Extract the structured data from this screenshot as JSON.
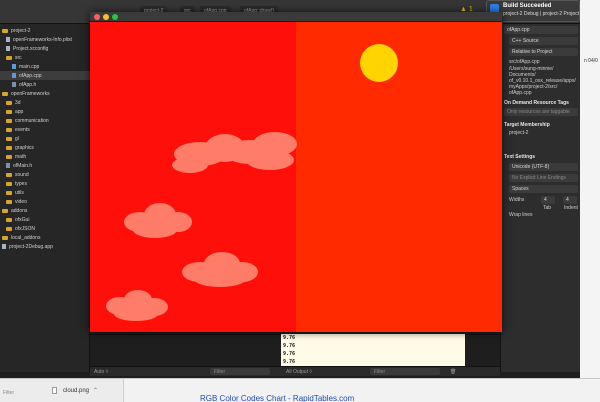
{
  "xcode": {
    "breadcrumb": [
      "project-2",
      "src",
      "ofApp.cpp",
      "ofApp::draw()"
    ],
    "warning_label": "▲ 1",
    "navigator": {
      "items": [
        {
          "label": "project-2",
          "icon": "folder"
        },
        {
          "label": "openFrameworks-Info.plist",
          "icon": "file"
        },
        {
          "label": "Project.xcconfig",
          "icon": "file"
        },
        {
          "label": "src",
          "icon": "folder"
        },
        {
          "label": "main.cpp",
          "icon": "cpp"
        },
        {
          "label": "ofApp.cpp",
          "icon": "cpp",
          "selected": true
        },
        {
          "label": "ofApp.h",
          "icon": "h"
        },
        {
          "label": "openFrameworks",
          "icon": "folder"
        },
        {
          "label": "3d",
          "icon": "folder"
        },
        {
          "label": "app",
          "icon": "folder"
        },
        {
          "label": "communication",
          "icon": "folder"
        },
        {
          "label": "events",
          "icon": "folder"
        },
        {
          "label": "gl",
          "icon": "folder"
        },
        {
          "label": "graphics",
          "icon": "folder"
        },
        {
          "label": "math",
          "icon": "folder"
        },
        {
          "label": "ofMain.h",
          "icon": "h"
        },
        {
          "label": "sound",
          "icon": "folder"
        },
        {
          "label": "types",
          "icon": "folder"
        },
        {
          "label": "utils",
          "icon": "folder"
        },
        {
          "label": "video",
          "icon": "folder"
        },
        {
          "label": "addons",
          "icon": "folder"
        },
        {
          "label": "ofxGui",
          "icon": "folder"
        },
        {
          "label": "ofxJSON",
          "icon": "folder"
        },
        {
          "label": "local_addons",
          "icon": "folder"
        },
        {
          "label": "project-2Debug.app",
          "icon": "file"
        }
      ],
      "filter_placeholder": "Filter"
    },
    "inspector": {
      "file_name": "ofApp.cpp",
      "file_type": "C++ Source",
      "location": "Relative to Project",
      "relative_path": "src/ofApp.cpp",
      "full_path_lines": [
        "/Users/sung-minnie/",
        "Documents/",
        "of_v0.10.1_osx_release/apps/",
        "myApps/project-2/src/",
        "ofApp.cpp"
      ],
      "resource_tags_header": "On Demand Resource Tags",
      "tags_placeholder": "Only resources are taggable",
      "target_membership_header": "Target Membership",
      "target": "project-2",
      "text_settings_header": "Text Settings",
      "encoding": "Unicode (UTF-8)",
      "line_endings": "No Explicit Line Endings",
      "indent_using": "Spaces",
      "widths_label": "Widths",
      "tab_width": "4",
      "indent_width": "4",
      "tab_label": "Tab",
      "indent_label": "Indent",
      "wrap_lines": "Wrap lines"
    },
    "console_lines": [
      "9.76",
      "9.76",
      "9.76",
      "9.76"
    ],
    "bottom": {
      "auto_label": "Auto ◊",
      "filter_placeholder": "Filter",
      "all_output": "All Output ◊",
      "output_filter_placeholder": "Filter"
    }
  },
  "notification": {
    "title": "Build Succeeded",
    "subtitle": "project-2 Debug | project-2 Project"
  },
  "of_window": {
    "colors": {
      "sky_left": "#ff0f0a",
      "sky_right": "#ff2a00",
      "sun": "#ffd400",
      "cloud": "#ff8a73"
    }
  },
  "browser": {
    "download_filename": "cloud.png",
    "link_text": "RGB Color Codes Chart - RapidTables.com",
    "sliver_text": "n 04/0"
  }
}
